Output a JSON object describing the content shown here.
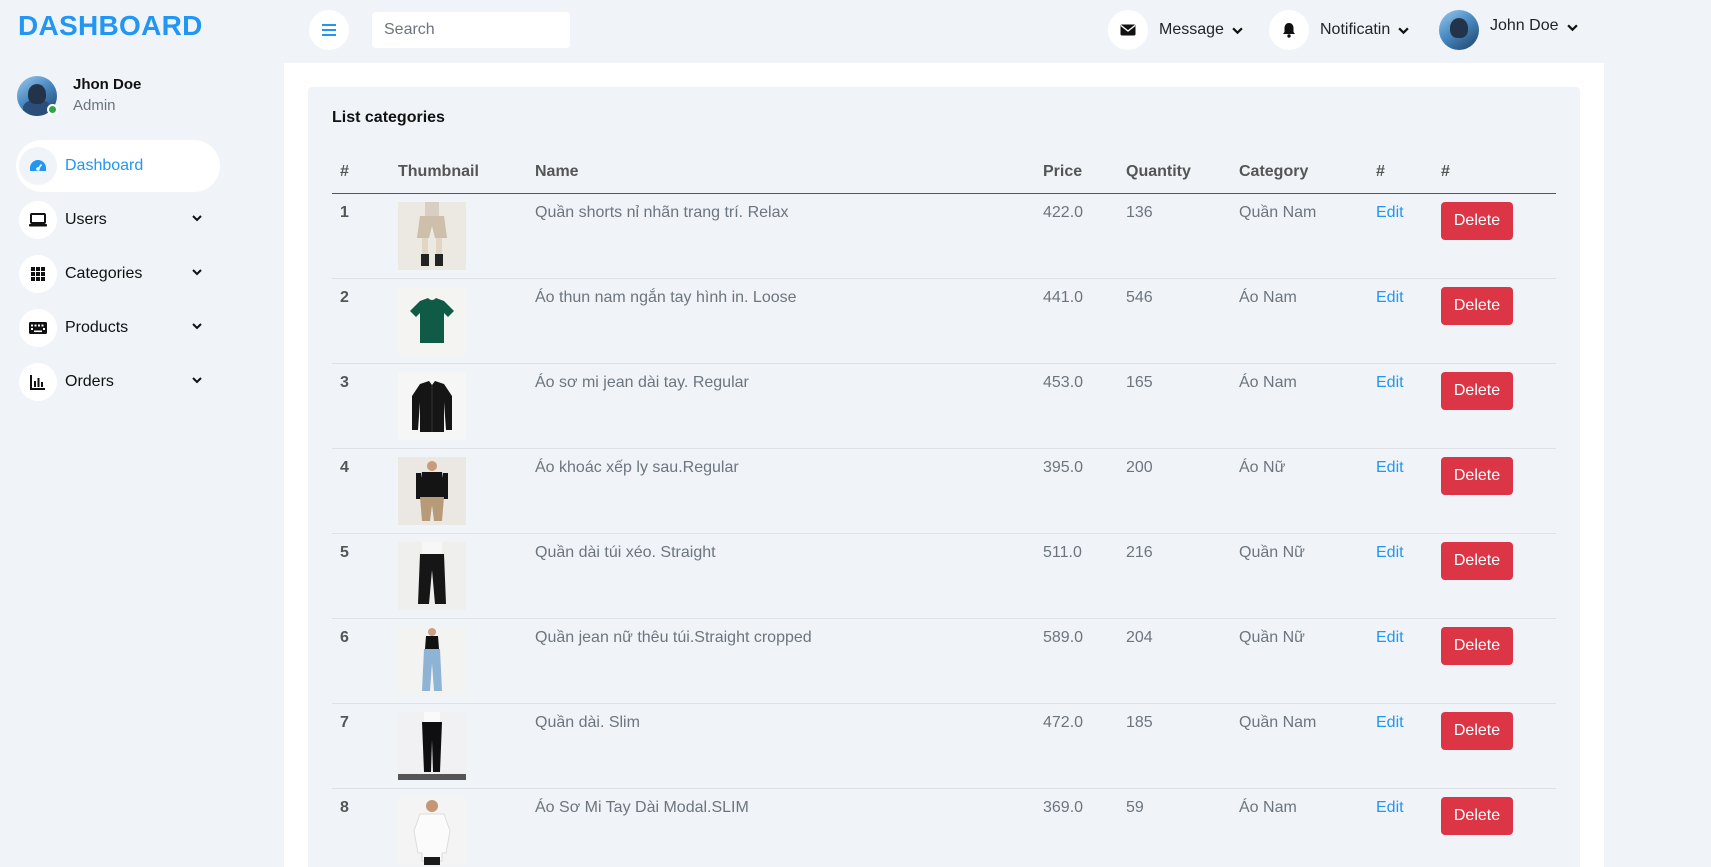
{
  "sidebar": {
    "brand": "DASHBOARD",
    "user_name": "Jhon Doe",
    "user_role": "Admin",
    "items": [
      {
        "label": "Dashboard",
        "icon": "gauge-icon",
        "active": true
      },
      {
        "label": "Users",
        "icon": "laptop-icon"
      },
      {
        "label": "Categories",
        "icon": "grid-icon"
      },
      {
        "label": "Products",
        "icon": "keyboard-icon"
      },
      {
        "label": "Orders",
        "icon": "bar-chart-icon"
      }
    ]
  },
  "topbar": {
    "search_placeholder": "Search",
    "message_label": "Message",
    "notification_label": "Notificatin",
    "user_label": "John Doe"
  },
  "main": {
    "title": "List categories",
    "columns": [
      "#",
      "Thumbnail",
      "Name",
      "Price",
      "Quantity",
      "Category",
      "#",
      "#"
    ],
    "edit_label": "Edit",
    "delete_label": "Delete",
    "rows": [
      {
        "id": "1",
        "name": "Quần shorts nỉ nhãn trang trí. Relax",
        "price": "422.0",
        "quantity": "136",
        "category": "Quần Nam",
        "thumb": "shorts"
      },
      {
        "id": "2",
        "name": "Áo thun nam ngắn tay hình in. Loose",
        "price": "441.0",
        "quantity": "546",
        "category": "Áo Nam",
        "thumb": "tshirt"
      },
      {
        "id": "3",
        "name": "Áo sơ mi jean dài tay. Regular",
        "price": "453.0",
        "quantity": "165",
        "category": "Áo Nam",
        "thumb": "shirt"
      },
      {
        "id": "4",
        "name": "Áo khoác xếp ly sau.Regular",
        "price": "395.0",
        "quantity": "200",
        "category": "Áo Nữ",
        "thumb": "jacket"
      },
      {
        "id": "5",
        "name": "Quần dài túi xéo. Straight",
        "price": "511.0",
        "quantity": "216",
        "category": "Quần Nữ",
        "thumb": "trousers"
      },
      {
        "id": "6",
        "name": "Quần jean nữ thêu túi.Straight cropped",
        "price": "589.0",
        "quantity": "204",
        "category": "Quần Nữ",
        "thumb": "jeans"
      },
      {
        "id": "7",
        "name": "Quần dài. Slim",
        "price": "472.0",
        "quantity": "185",
        "category": "Quần Nam",
        "thumb": "slim"
      },
      {
        "id": "8",
        "name": "Áo Sơ Mi Tay Dài Modal.SLIM",
        "price": "369.0",
        "quantity": "59",
        "category": "Áo Nam",
        "thumb": "whiteshirt"
      }
    ]
  },
  "colors": {
    "accent": "#2196f3",
    "danger": "#dc3545",
    "background": "#f0f4f9",
    "online": "#28a745"
  }
}
